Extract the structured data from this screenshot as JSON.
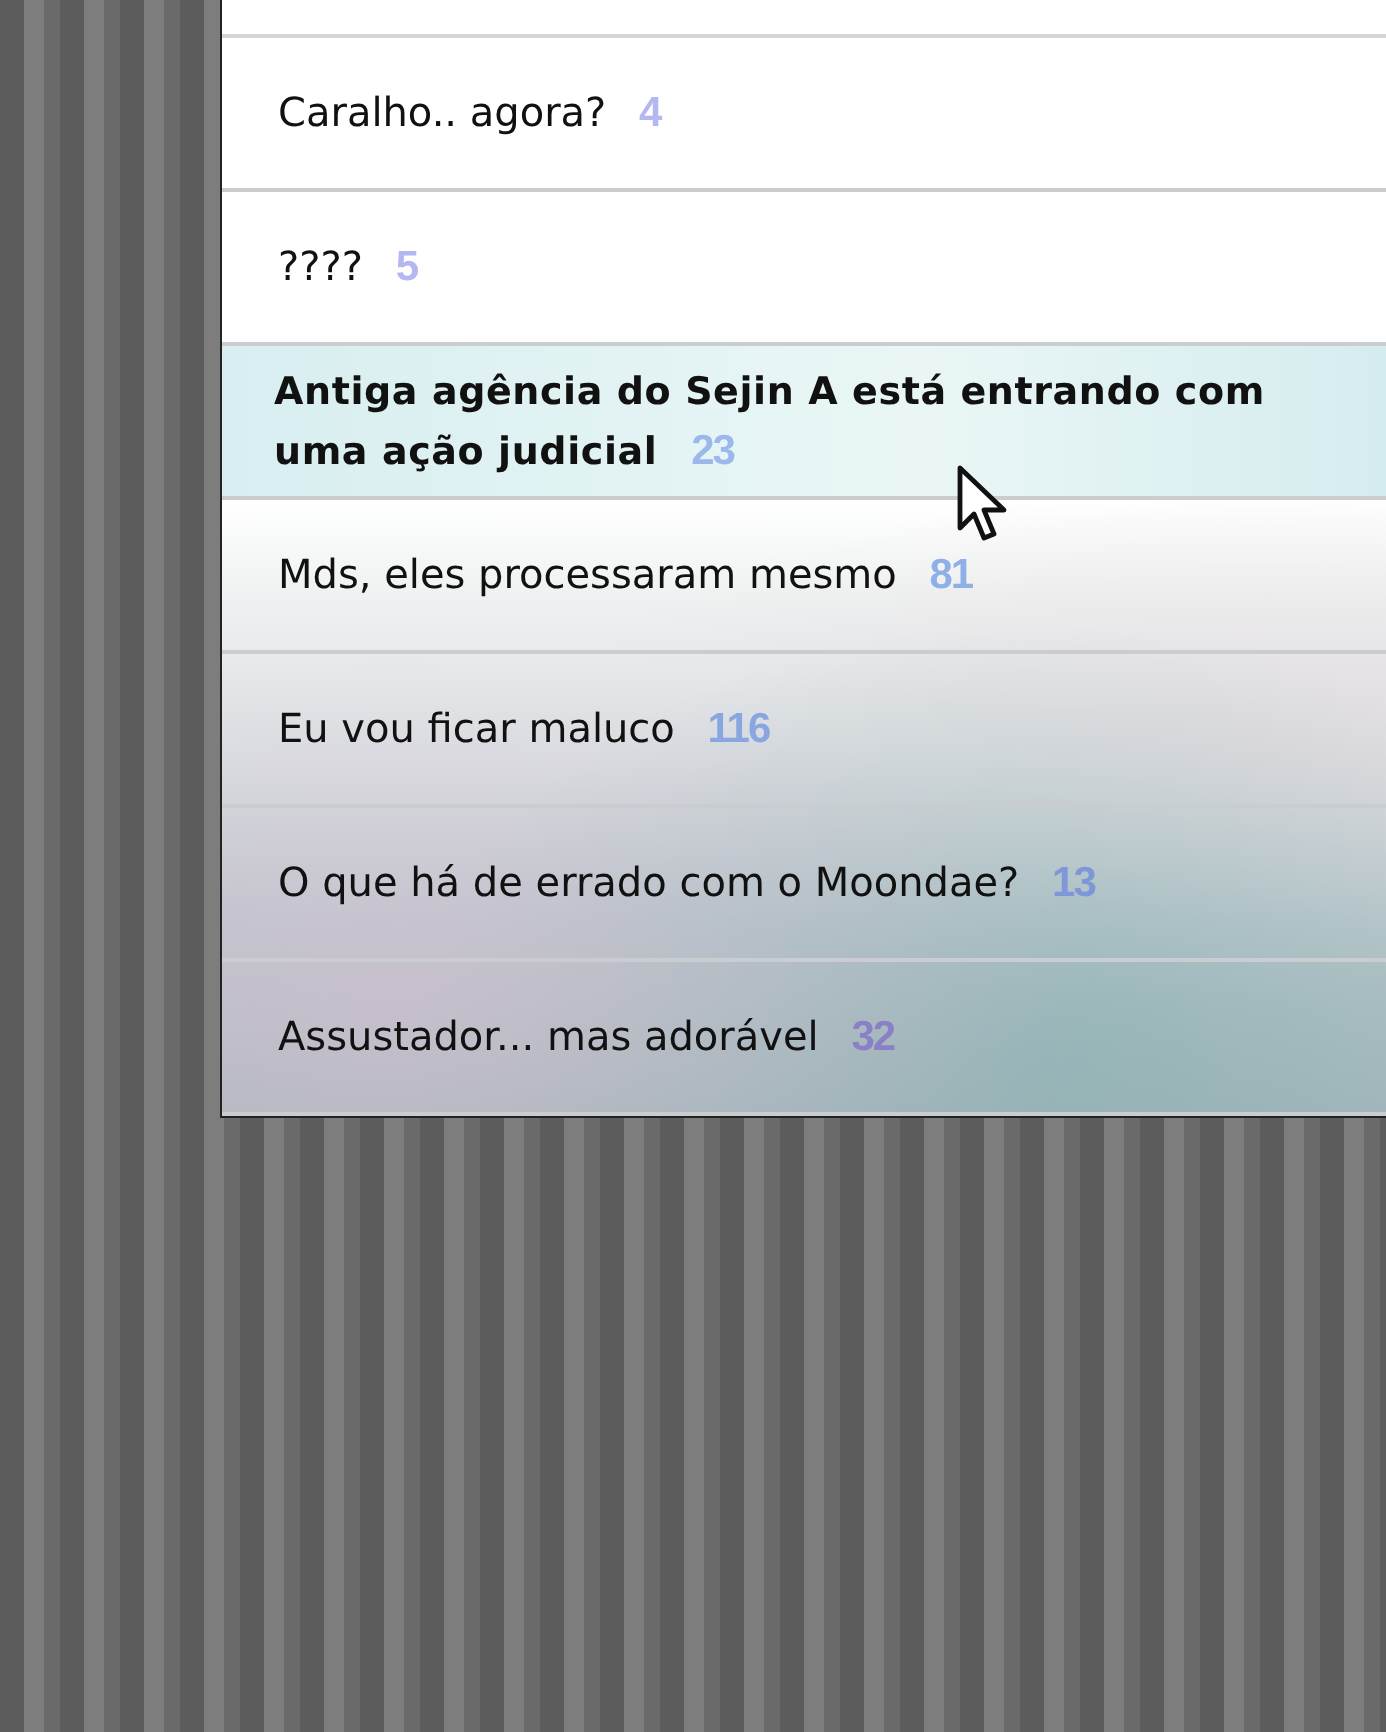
{
  "topics": [
    {
      "title": "Caralho.. agora?",
      "replies": "4",
      "selected": false,
      "color": "#b4b8f0"
    },
    {
      "title": "????",
      "replies": "5",
      "selected": false,
      "color": "#b4b8f0"
    },
    {
      "title": "Antiga agência do Sejin A está entrando com uma ação judicial",
      "replies": "23",
      "selected": true,
      "color": "#9ab8ec"
    },
    {
      "title": "Mds, eles processaram mesmo",
      "replies": "81",
      "selected": false,
      "color": "#8fb0e6"
    },
    {
      "title": "Eu vou ficar maluco",
      "replies": "116",
      "selected": false,
      "color": "#8aa6e0"
    },
    {
      "title": "O que há de errado com o Moondae?",
      "replies": "13",
      "selected": false,
      "color": "#7f96d8"
    },
    {
      "title": "Assustador... mas adorável",
      "replies": "32",
      "selected": false,
      "color": "#8a80c8"
    }
  ]
}
